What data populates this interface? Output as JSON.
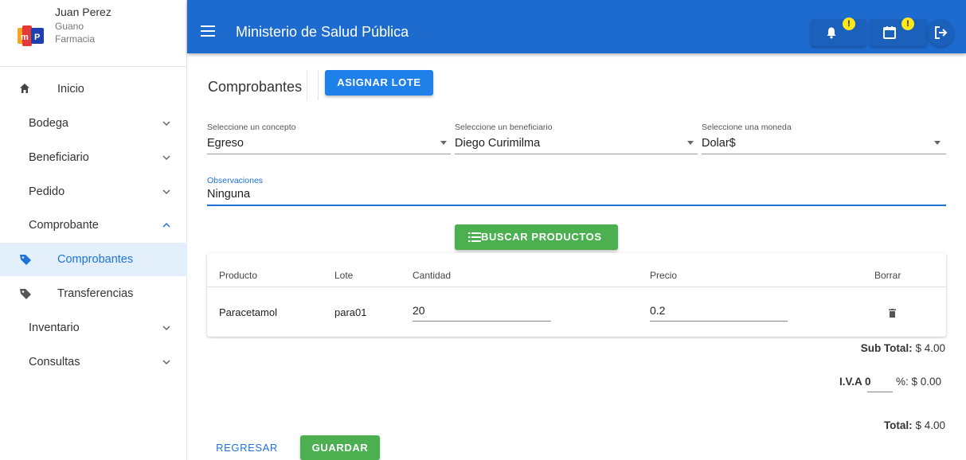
{
  "user": {
    "name": "Juan Perez",
    "city": "Guano",
    "place": "Farmacia"
  },
  "sidebar": {
    "items": [
      {
        "label": "Inicio"
      },
      {
        "label": "Bodega"
      },
      {
        "label": "Beneficiario"
      },
      {
        "label": "Pedido"
      },
      {
        "label": "Comprobante"
      },
      {
        "label": "Comprobantes"
      },
      {
        "label": "Transferencias"
      },
      {
        "label": "Inventario"
      },
      {
        "label": "Consultas"
      }
    ]
  },
  "header": {
    "title": "Ministerio de Salud Pública",
    "notif_badge": "!",
    "calendar_badge": "!"
  },
  "page": {
    "title": "Comprobantes",
    "assign_button": "ASIGNAR LOTE"
  },
  "form": {
    "concept": {
      "label": "Seleccione un concepto",
      "value": "Egreso"
    },
    "beneficiary": {
      "label": "Seleccione un beneficiario",
      "value": "Diego Curimilma"
    },
    "currency": {
      "label": "Seleccione una moneda",
      "value": "Dolar$"
    },
    "observations": {
      "label": "Observaciones",
      "value": "Ninguna"
    },
    "search_button": "BUSCAR PRODUCTOS"
  },
  "table": {
    "headers": [
      "Producto",
      "Lote",
      "Cantidad",
      "Precio",
      "Borrar"
    ],
    "rows": [
      {
        "product": "Paracetamol",
        "lot": "para01",
        "quantity": "20",
        "price": "0.2"
      }
    ]
  },
  "totals": {
    "subtotal_label": "Sub Total:",
    "subtotal_value": "$ 4.00",
    "iva_label": "I.V.A 0",
    "iva_suffix": "%: $ 0.00",
    "total_label": "Total:",
    "total_value": "$ 4.00"
  },
  "footer": {
    "back_button": "REGRESAR",
    "save_button": "GUARDAR"
  },
  "colors": {
    "primary": "#1e6bd0",
    "accent": "#1e80e8",
    "success": "#4caf50",
    "badge": "#ffe81a",
    "active_bg": "#e3effb"
  }
}
